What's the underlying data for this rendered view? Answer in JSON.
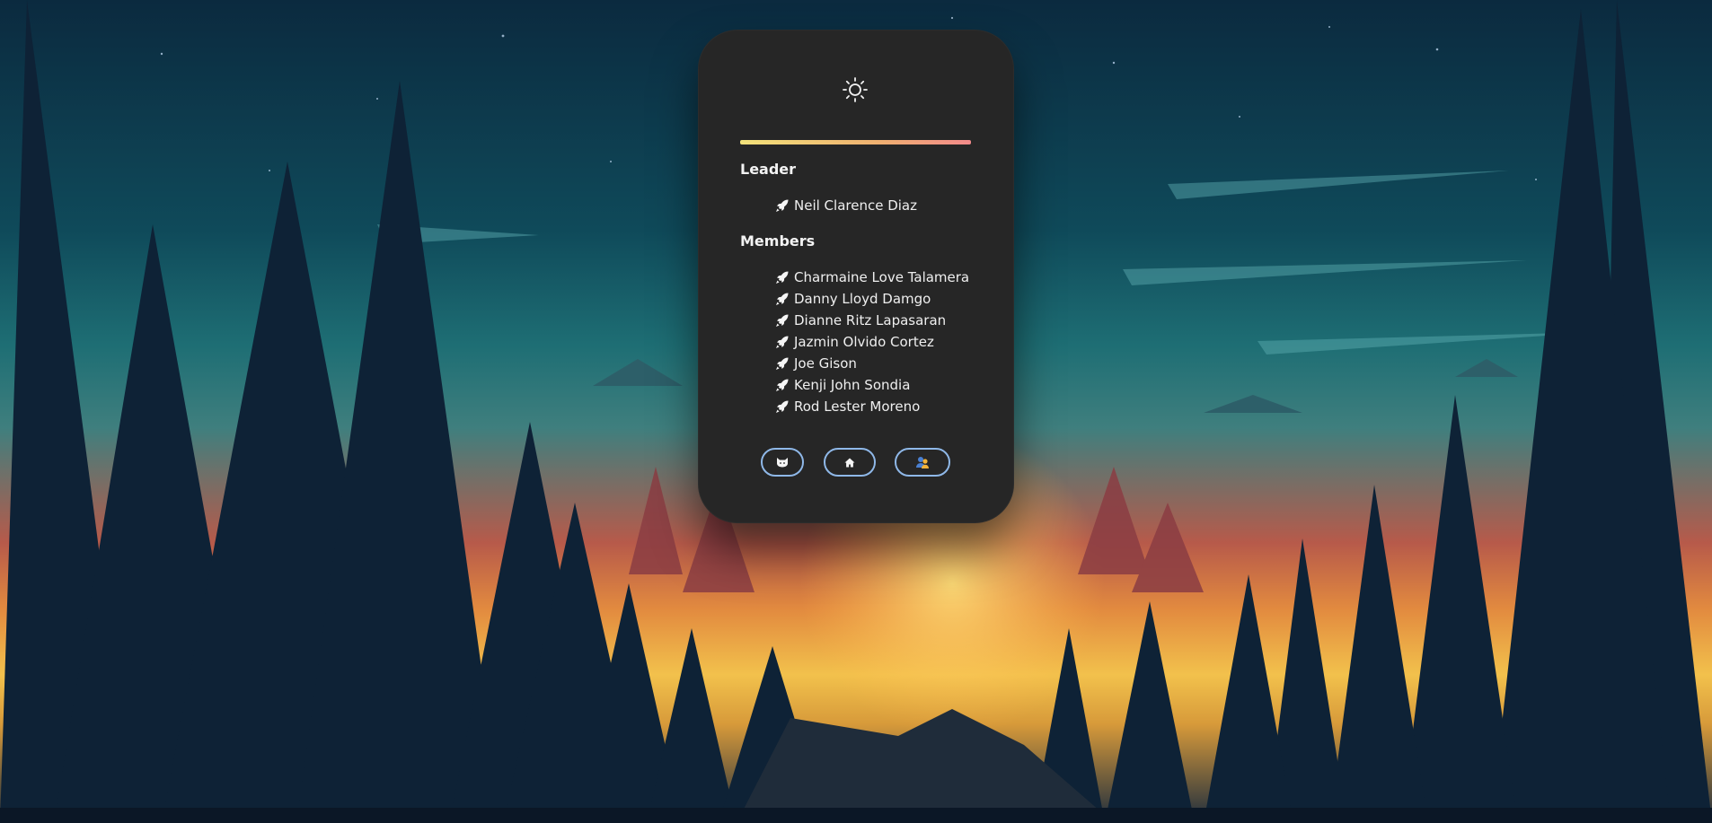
{
  "theme": {
    "toggle_icon": "sun-icon",
    "accent_gradient": [
      "#f2e27a",
      "#f0b070",
      "#f28a8a"
    ],
    "card_background": "#262626",
    "button_border": "#8fb8e8"
  },
  "team": {
    "leader_heading": "Leader",
    "leader": {
      "name": "Neil Clarence Diaz",
      "icon": "rocket-icon"
    },
    "members_heading": "Members",
    "members": [
      {
        "name": "Charmaine Love Talamera",
        "icon": "rocket-icon"
      },
      {
        "name": "Danny Lloyd Damgo",
        "icon": "rocket-icon"
      },
      {
        "name": "Dianne Ritz Lapasaran",
        "icon": "rocket-icon"
      },
      {
        "name": "Jazmin Olvido Cortez",
        "icon": "rocket-icon"
      },
      {
        "name": "Joe Gison",
        "icon": "rocket-icon"
      },
      {
        "name": "Kenji John Sondia",
        "icon": "rocket-icon"
      },
      {
        "name": "Rod Lester Moreno",
        "icon": "rocket-icon"
      }
    ]
  },
  "actions": [
    {
      "name": "github-button",
      "icon": "github-cat-icon"
    },
    {
      "name": "home-button",
      "icon": "home-icon"
    },
    {
      "name": "team-button",
      "icon": "people-icon"
    }
  ]
}
